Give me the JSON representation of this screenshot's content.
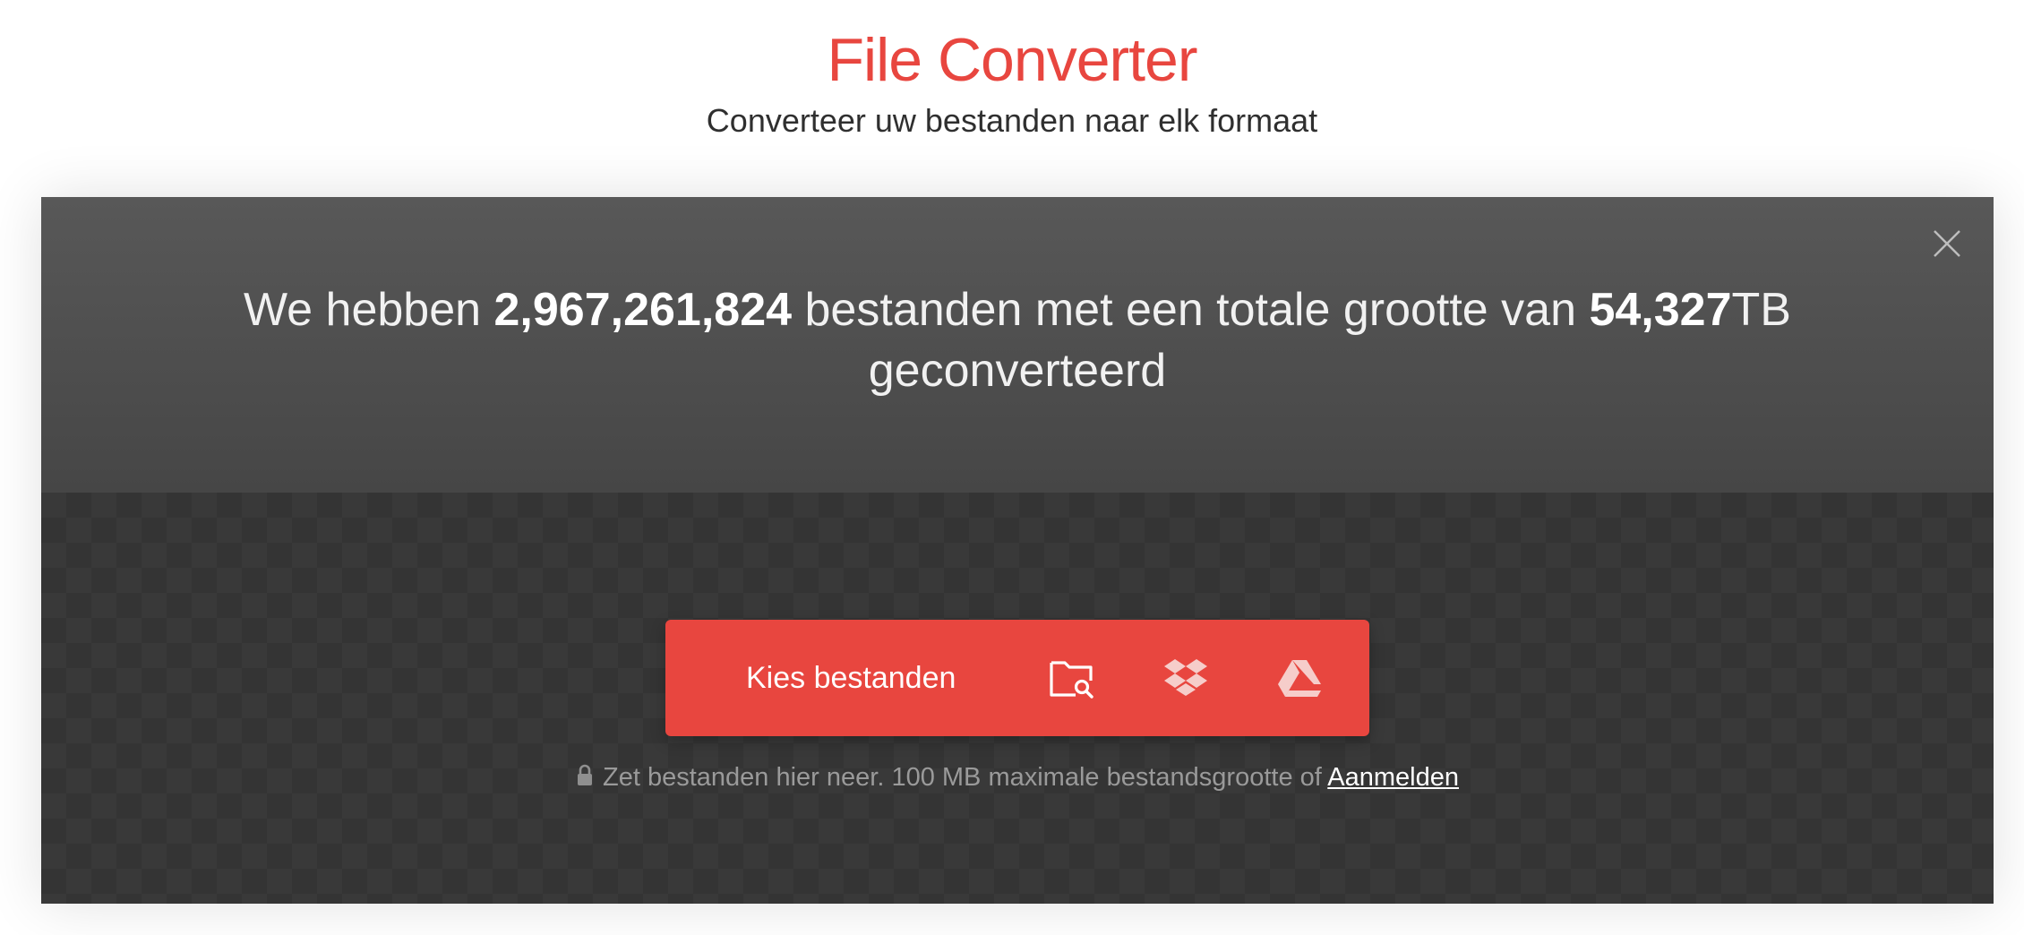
{
  "header": {
    "title": "File Converter",
    "subtitle": "Converteer uw bestanden naar elk formaat"
  },
  "stats": {
    "prefix": "We hebben ",
    "file_count": "2,967,261,824",
    "middle": " bestanden met een totale grootte van ",
    "total_size": "54,327",
    "unit": "TB",
    "suffix": "geconverteerd"
  },
  "upload": {
    "choose_label": "Kies bestanden",
    "sources": [
      {
        "icon": "folder-search-icon"
      },
      {
        "icon": "dropbox-icon"
      },
      {
        "icon": "google-drive-icon"
      }
    ]
  },
  "drop_hint": {
    "text": "Zet bestanden hier neer. 100 MB maximale bestandsgrootte of ",
    "link": "Aanmelden"
  },
  "colors": {
    "accent": "#e8463f",
    "panel_top": "#505050",
    "panel_bottom": "#393939"
  },
  "icons": {
    "close": "close-icon",
    "lock": "lock-icon"
  }
}
